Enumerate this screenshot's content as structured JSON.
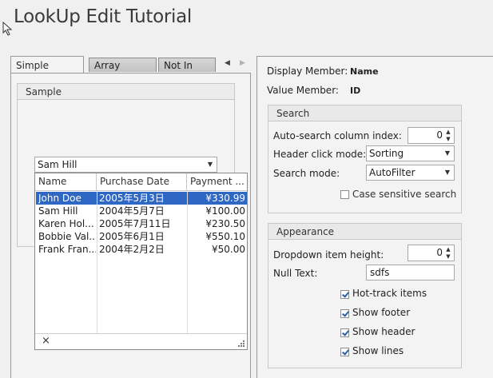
{
  "window": {
    "title": "LookUp Edit Tutorial"
  },
  "tabs": {
    "items": [
      {
        "label": "Simple Binding",
        "active": true
      },
      {
        "label": "Array Binding",
        "active": false
      },
      {
        "label": "Not In List",
        "active": false
      }
    ],
    "prev_icon": "triangle-left-icon",
    "next_icon": "triangle-right-icon"
  },
  "sample": {
    "group_label": "Sample",
    "lookup_value": "Sam Hill",
    "popup": {
      "columns": [
        "Name",
        "Purchase Date",
        "Payment ..."
      ],
      "rows": [
        {
          "name": "John Doe",
          "date": "2005年5月3日",
          "payment": "¥330.99",
          "selected": true
        },
        {
          "name": "Sam Hill",
          "date": "2004年5月7日",
          "payment": "¥100.00",
          "selected": false
        },
        {
          "name": "Karen Hol...",
          "date": "2005年7月11日",
          "payment": "¥230.50",
          "selected": false
        },
        {
          "name": "Bobbie Val...",
          "date": "2005年6月1日",
          "payment": "¥550.10",
          "selected": false
        },
        {
          "name": "Frank Fran...",
          "date": "2004年2月2日",
          "payment": "¥50.00",
          "selected": false
        }
      ],
      "close_glyph": "×"
    }
  },
  "info": {
    "display_member_label": "Display Member:",
    "display_member_value": "Name",
    "value_member_label": "Value Member:",
    "value_member_value": "ID"
  },
  "search": {
    "group_label": "Search",
    "autosearch_label": "Auto-search column index:",
    "autosearch_value": "0",
    "header_click_label": "Header click mode:",
    "header_click_value": "Sorting",
    "search_mode_label": "Search mode:",
    "search_mode_value": "AutoFilter",
    "case_sensitive_label": "Case sensitive search",
    "case_sensitive_checked": false
  },
  "appearance": {
    "group_label": "Appearance",
    "dropdown_height_label": "Dropdown item height:",
    "dropdown_height_value": "0",
    "null_text_label": "Null Text:",
    "null_text_value": "sdfs",
    "checks": [
      {
        "label": "Hot-track items",
        "checked": true
      },
      {
        "label": "Show footer",
        "checked": true
      },
      {
        "label": "Show header",
        "checked": true
      },
      {
        "label": "Show lines",
        "checked": true
      }
    ]
  }
}
